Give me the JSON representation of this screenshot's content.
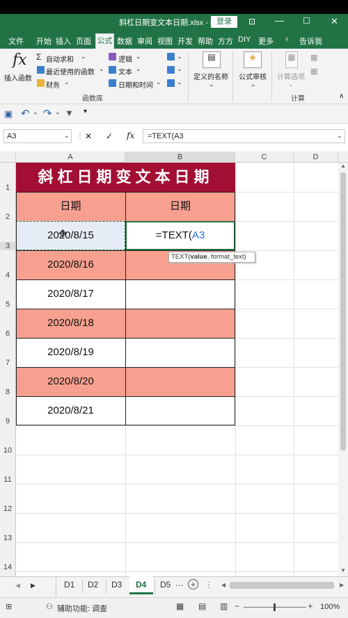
{
  "title_bar": {
    "title": "斜杠日期变文本日期.xlsx - Excel",
    "login_label": "登录"
  },
  "ribbon_tabs": [
    "文件",
    "开始",
    "插入",
    "页面",
    "公式",
    "数据",
    "审阅",
    "视图",
    "开发",
    "帮助",
    "方方",
    "DIY",
    "更多",
    "告诉我"
  ],
  "ribbon": {
    "insert_function": "插入函数",
    "autosum": "自动求和",
    "recent": "最近使用的函数",
    "financial": "财务",
    "logical": "逻辑",
    "text": "文本",
    "datetime": "日期和时间",
    "group_library": "函数库",
    "defined_names": "定义的名称",
    "formula_audit": "公式审核",
    "calc_options": "计算选项",
    "group_calc": "计算"
  },
  "formula_bar": {
    "name_box": "A3",
    "cancel": "✕",
    "enter": "✓",
    "fx": "fx",
    "formula": "=TEXT(A3"
  },
  "columns": [
    "A",
    "B",
    "C",
    "D"
  ],
  "rows": [
    "1",
    "2",
    "3",
    "4",
    "5",
    "6",
    "7",
    "8",
    "9",
    "10",
    "11",
    "12",
    "13",
    "14"
  ],
  "sheet": {
    "banner": "斜杠日期变文本日期",
    "header_a": "日期",
    "header_b": "日期",
    "dates": [
      "2020/8/15",
      "2020/8/16",
      "2020/8/17",
      "2020/8/18",
      "2020/8/19",
      "2020/8/20",
      "2020/8/21"
    ],
    "edit_prefix": "=TEXT(",
    "edit_ref": "A3",
    "tooltip_fn": "TEXT(",
    "tooltip_arg1": "value",
    "tooltip_rest": ", format_text)"
  },
  "sheet_tabs": [
    "D1",
    "D2",
    "D3",
    "D4",
    "D5"
  ],
  "active_sheet": "D4",
  "status": {
    "accessibility": "辅助功能: 调查",
    "zoom": "100%"
  },
  "colors": {
    "excel_green": "#217346",
    "banner_red": "#a30f34",
    "salmon": "#f8a08f",
    "ref_blue": "#2f6fd6"
  }
}
